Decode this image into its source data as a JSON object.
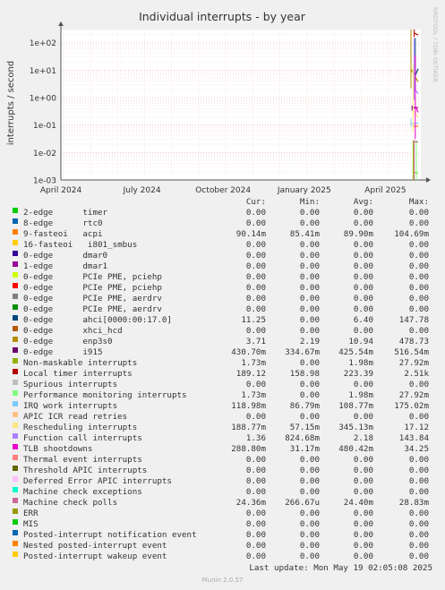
{
  "chart_data": {
    "type": "line",
    "title": "Individual interrupts - by year",
    "ylabel": "interrupts / second",
    "yscale": "log",
    "ylim": [
      0.001,
      300
    ],
    "y_ticks": [
      "1e-03",
      "1e-02",
      "1e-01",
      "1e+00",
      "1e+01",
      "1e+02"
    ],
    "x_ticks": [
      "April 2024",
      "July 2024",
      "October 2024",
      "January 2025",
      "April 2025"
    ],
    "side_label": "RRDTOOL / TOBI OETIKER",
    "grid": true,
    "legend_header": {
      "cur": "Cur:",
      "min": "Min:",
      "avg": "Avg:",
      "max": "Max:"
    },
    "series": [
      {
        "name": "2-edge      timer",
        "color": "#00cc00",
        "cur": "0.00",
        "min": "0.00",
        "avg": "0.00",
        "max": "0.00"
      },
      {
        "name": "8-edge      rtc0",
        "color": "#0066b3",
        "cur": "0.00",
        "min": "0.00",
        "avg": "0.00",
        "max": "0.00"
      },
      {
        "name": "9-fasteoi   acpi",
        "color": "#ff8000",
        "cur": "90.14m",
        "min": "85.41m",
        "avg": "89.90m",
        "max": "104.69m"
      },
      {
        "name": "16-fasteoi   i801_smbus",
        "color": "#ffcc00",
        "cur": "0.00",
        "min": "0.00",
        "avg": "0.00",
        "max": "0.00"
      },
      {
        "name": "0-edge      dmar0",
        "color": "#330099",
        "cur": "0.00",
        "min": "0.00",
        "avg": "0.00",
        "max": "0.00"
      },
      {
        "name": "1-edge      dmar1",
        "color": "#990099",
        "cur": "0.00",
        "min": "0.00",
        "avg": "0.00",
        "max": "0.00"
      },
      {
        "name": "0-edge      PCIe PME, pciehp",
        "color": "#ccff00",
        "cur": "0.00",
        "min": "0.00",
        "avg": "0.00",
        "max": "0.00"
      },
      {
        "name": "0-edge      PCIe PME, pciehp",
        "color": "#ff0000",
        "cur": "0.00",
        "min": "0.00",
        "avg": "0.00",
        "max": "0.00"
      },
      {
        "name": "0-edge      PCIe PME, aerdrv",
        "color": "#808080",
        "cur": "0.00",
        "min": "0.00",
        "avg": "0.00",
        "max": "0.00"
      },
      {
        "name": "0-edge      PCIe PME, aerdrv",
        "color": "#008f00",
        "cur": "0.00",
        "min": "0.00",
        "avg": "0.00",
        "max": "0.00"
      },
      {
        "name": "0-edge      ahci[0000:00:17.0]",
        "color": "#00487d",
        "cur": "11.25",
        "min": "0.00",
        "avg": "6.40",
        "max": "147.78"
      },
      {
        "name": "0-edge      xhci_hcd",
        "color": "#b35a00",
        "cur": "0.00",
        "min": "0.00",
        "avg": "0.00",
        "max": "0.00"
      },
      {
        "name": "0-edge      enp3s0",
        "color": "#b38f00",
        "cur": "3.71",
        "min": "2.19",
        "avg": "10.94",
        "max": "478.73"
      },
      {
        "name": "0-edge      i915",
        "color": "#6b006b",
        "cur": "430.70m",
        "min": "334.67m",
        "avg": "425.54m",
        "max": "516.54m"
      },
      {
        "name": "Non-maskable interrupts",
        "color": "#8fb300",
        "cur": "1.73m",
        "min": "0.00",
        "avg": "1.98m",
        "max": "27.92m"
      },
      {
        "name": "Local timer interrupts",
        "color": "#b30000",
        "cur": "189.12",
        "min": "158.98",
        "avg": "223.39",
        "max": "2.51k"
      },
      {
        "name": "Spurious interrupts",
        "color": "#bebebe",
        "cur": "0.00",
        "min": "0.00",
        "avg": "0.00",
        "max": "0.00"
      },
      {
        "name": "Performance monitoring interrupts",
        "color": "#80ff80",
        "cur": "1.73m",
        "min": "0.00",
        "avg": "1.98m",
        "max": "27.92m"
      },
      {
        "name": "IRQ work interrupts",
        "color": "#80c9ff",
        "cur": "118.98m",
        "min": "86.79m",
        "avg": "108.77m",
        "max": "175.02m"
      },
      {
        "name": "APIC ICR read retries",
        "color": "#ffc080",
        "cur": "0.00",
        "min": "0.00",
        "avg": "0.00",
        "max": "0.00"
      },
      {
        "name": "Rescheduling interrupts",
        "color": "#ffe680",
        "cur": "188.77m",
        "min": "57.15m",
        "avg": "345.13m",
        "max": "17.12"
      },
      {
        "name": "Function call interrupts",
        "color": "#aa80ff",
        "cur": "1.36",
        "min": "824.68m",
        "avg": "2.18",
        "max": "143.84"
      },
      {
        "name": "TLB shootdowns",
        "color": "#ee00cc",
        "cur": "288.80m",
        "min": "31.17m",
        "avg": "480.42m",
        "max": "34.25"
      },
      {
        "name": "Thermal event interrupts",
        "color": "#ff8080",
        "cur": "0.00",
        "min": "0.00",
        "avg": "0.00",
        "max": "0.00"
      },
      {
        "name": "Threshold APIC interrupts",
        "color": "#666600",
        "cur": "0.00",
        "min": "0.00",
        "avg": "0.00",
        "max": "0.00"
      },
      {
        "name": "Deferred Error APIC interrupts",
        "color": "#ffbfff",
        "cur": "0.00",
        "min": "0.00",
        "avg": "0.00",
        "max": "0.00"
      },
      {
        "name": "Machine check exceptions",
        "color": "#00ffcc",
        "cur": "0.00",
        "min": "0.00",
        "avg": "0.00",
        "max": "0.00"
      },
      {
        "name": "Machine check polls",
        "color": "#cc6699",
        "cur": "24.36m",
        "min": "266.67u",
        "avg": "24.40m",
        "max": "28.83m"
      },
      {
        "name": "ERR",
        "color": "#999900",
        "cur": "0.00",
        "min": "0.00",
        "avg": "0.00",
        "max": "0.00"
      },
      {
        "name": "MIS",
        "color": "#00cc00",
        "cur": "0.00",
        "min": "0.00",
        "avg": "0.00",
        "max": "0.00"
      },
      {
        "name": "Posted-interrupt notification event",
        "color": "#0066b3",
        "cur": "0.00",
        "min": "0.00",
        "avg": "0.00",
        "max": "0.00"
      },
      {
        "name": "Nested posted-interrupt event",
        "color": "#ff8000",
        "cur": "0.00",
        "min": "0.00",
        "avg": "0.00",
        "max": "0.00"
      },
      {
        "name": "Posted-interrupt wakeup event",
        "color": "#ffcc00",
        "cur": "0.00",
        "min": "0.00",
        "avg": "0.00",
        "max": "0.00"
      }
    ]
  },
  "footer": {
    "last_update": "Last update: Mon May 19 02:05:08 2025",
    "version": "Munin 2.0.57"
  }
}
